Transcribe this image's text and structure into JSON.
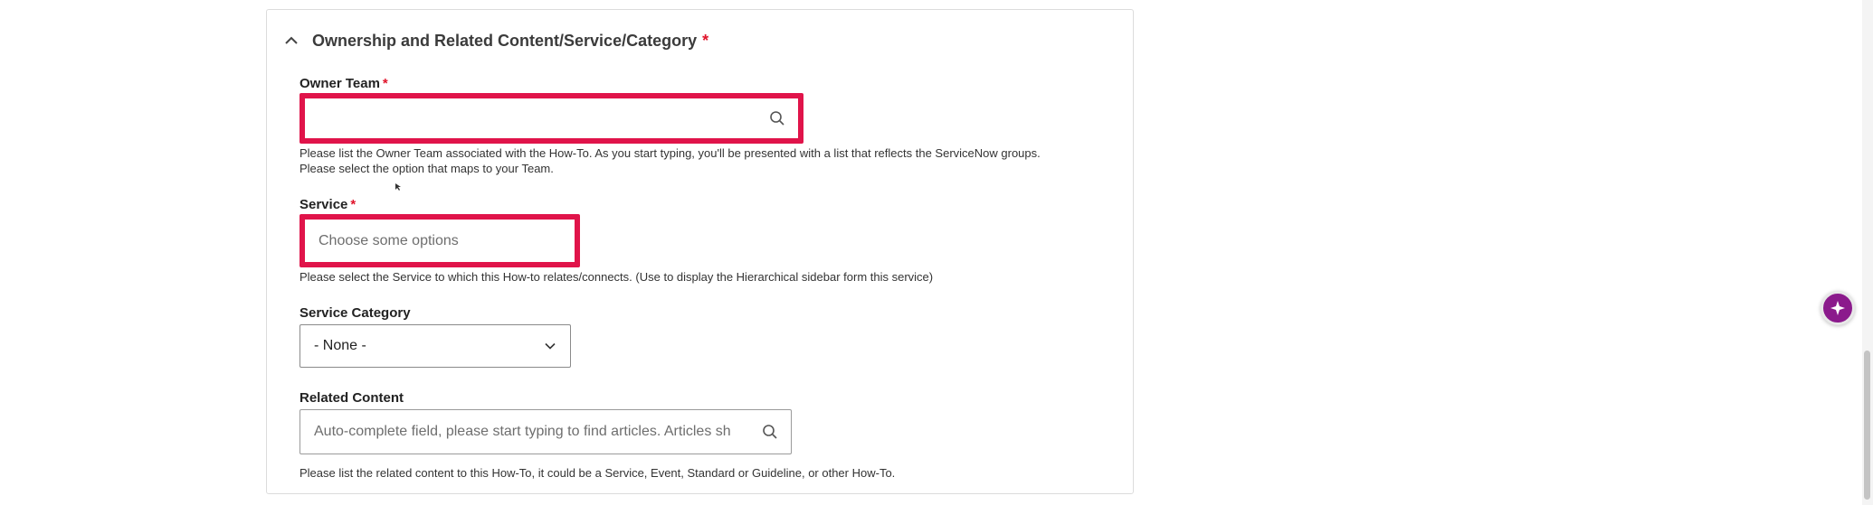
{
  "section": {
    "title": "Ownership and Related Content/Service/Category",
    "required_marker": "*"
  },
  "owner_team": {
    "label": "Owner Team",
    "required_marker": "*",
    "value": "",
    "help_line1": "Please list the Owner Team associated with the How-To. As you start typing, you'll be presented with a list that reflects the ServiceNow groups.",
    "help_line2": "Please select the option that maps to your Team."
  },
  "service": {
    "label": "Service",
    "required_marker": "*",
    "placeholder": "Choose some options",
    "help": "Please select the Service to which this How-to relates/connects. (Use to display the Hierarchical sidebar form this service)"
  },
  "service_category": {
    "label": "Service Category",
    "selected": "- None -"
  },
  "related_content": {
    "label": "Related Content",
    "placeholder": "Auto-complete field, please start typing to find articles.   Articles sh",
    "help": "Please list the related content to this How-To, it could be a Service, Event, Standard or Guideline, or other How-To."
  },
  "icons": {
    "collapse": "chevron-up-icon",
    "search": "search-icon",
    "dropdown": "chevron-down-icon",
    "assistant": "sparkle-icon"
  },
  "colors": {
    "required": "#e0142b",
    "error_border": "#e0144a",
    "assistant_bg": "#8b1a8c"
  }
}
